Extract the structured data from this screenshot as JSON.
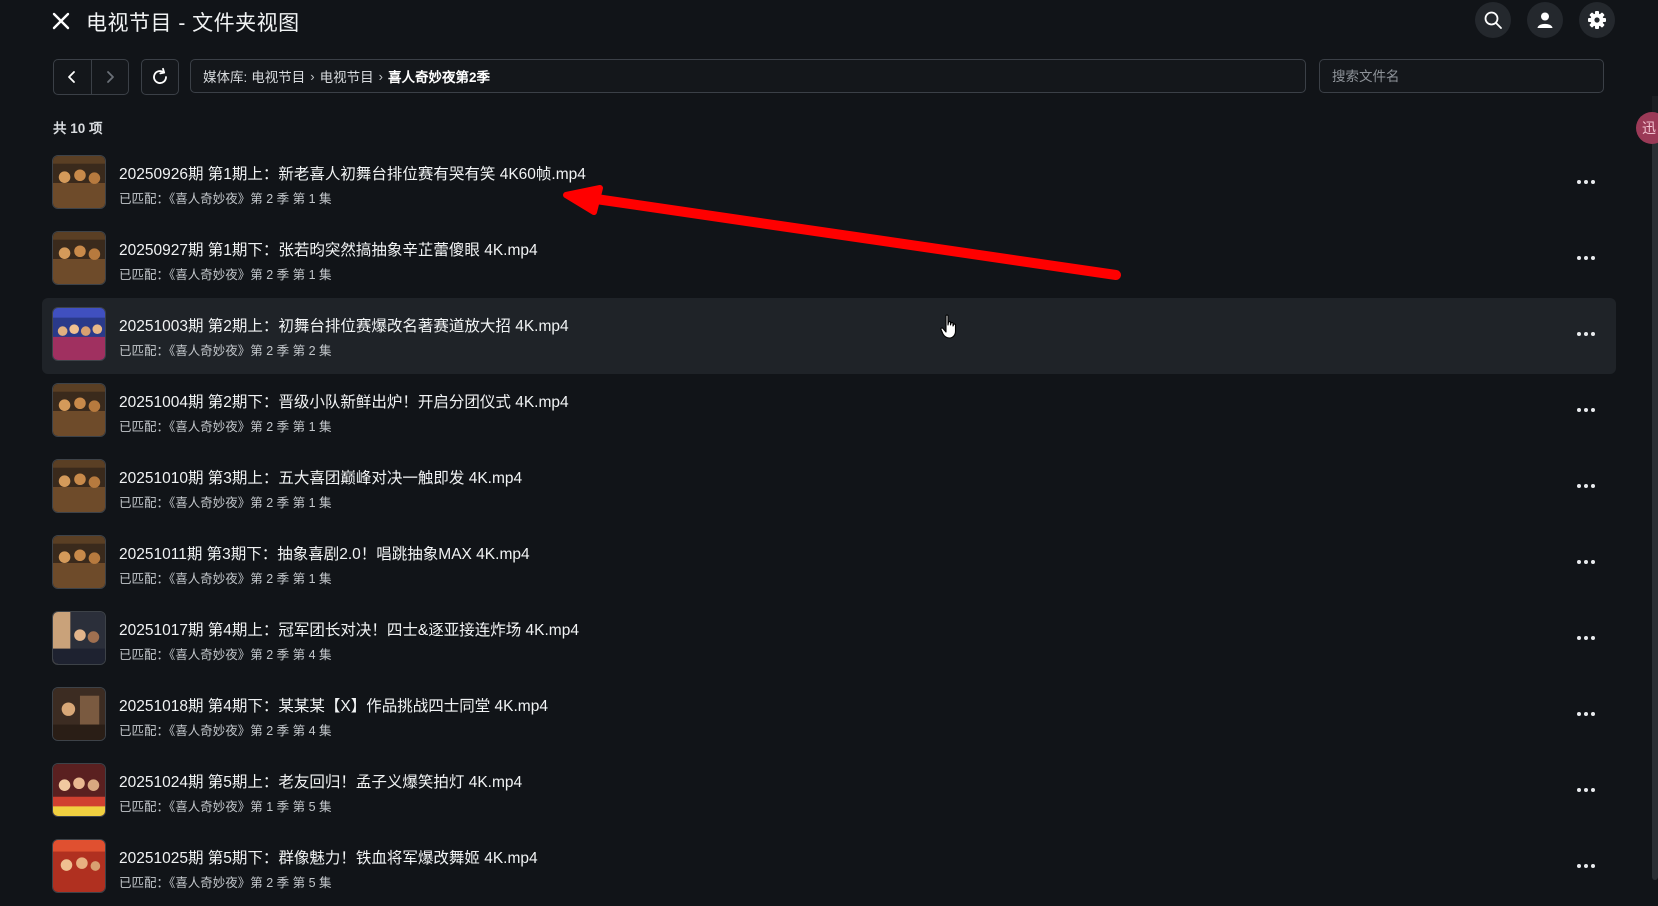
{
  "header": {
    "title": "电视节目 - 文件夹视图",
    "icons": [
      "close-icon",
      "search-icon",
      "user-icon",
      "gear-icon"
    ]
  },
  "toolbar": {
    "breadcrumb": {
      "prefix": "媒体库:",
      "items": [
        "电视节目",
        "电视节目",
        "喜人奇妙夜第2季"
      ]
    },
    "search_placeholder": "搜索文件名"
  },
  "list": {
    "count_label": "共 10 项",
    "items": [
      {
        "name": "20250926期 第1期上：新老喜人初舞台排位赛有哭有笑 4K60帧.mp4",
        "match": "已匹配：《喜人奇妙夜》第 2 季 第 1 集"
      },
      {
        "name": "20250927期 第1期下：张若昀突然搞抽象辛芷蕾傻眼 4K.mp4",
        "match": "已匹配：《喜人奇妙夜》第 2 季 第 1 集"
      },
      {
        "name": "20251003期 第2期上：初舞台排位赛爆改名著赛道放大招 4K.mp4",
        "match": "已匹配：《喜人奇妙夜》第 2 季 第 2 集"
      },
      {
        "name": "20251004期 第2期下：晋级小队新鲜出炉！开启分团仪式 4K.mp4",
        "match": "已匹配：《喜人奇妙夜》第 2 季 第 1 集"
      },
      {
        "name": "20251010期 第3期上：五大喜团巅峰对决一触即发 4K.mp4",
        "match": "已匹配：《喜人奇妙夜》第 2 季 第 1 集"
      },
      {
        "name": "20251011期 第3期下：抽象喜剧2.0！唱跳抽象MAX 4K.mp4",
        "match": "已匹配：《喜人奇妙夜》第 2 季 第 1 集"
      },
      {
        "name": "20251017期 第4期上：冠军团长对决！四士&逐亚接连炸场 4K.mp4",
        "match": "已匹配：《喜人奇妙夜》第 2 季 第 4 集"
      },
      {
        "name": "20251018期 第4期下：某某某【X】作品挑战四士同堂 4K.mp4",
        "match": "已匹配：《喜人奇妙夜》第 2 季 第 4 集"
      },
      {
        "name": "20251024期 第5期上：老友回归！孟子义爆笑拍灯 4K.mp4",
        "match": "已匹配：《喜人奇妙夜》第 1 季 第 5 集"
      },
      {
        "name": "20251025期 第5期下：群像魅力！铁血将军爆改舞姬 4K.mp4",
        "match": "已匹配：《喜人奇妙夜》第 2 季 第 5 集"
      }
    ]
  },
  "side_badge": "迅",
  "colors": {
    "background": "#111418",
    "row_hover": "#1f2328",
    "annotation_arrow": "#ff0000"
  }
}
